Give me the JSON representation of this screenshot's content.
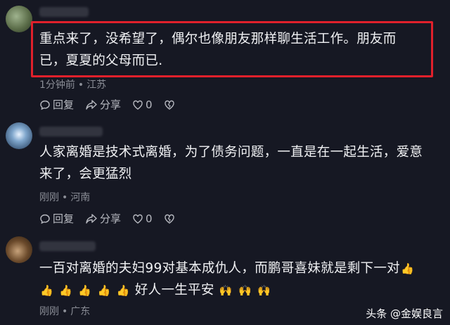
{
  "comments": [
    {
      "text": "重点来了，没希望了，偶尔也像朋友那样聊生活工作。朋友而已，夏夏的父母而已.",
      "time": "1分钟前",
      "location": "江苏",
      "reply_label": "回复",
      "share_label": "分享",
      "likes": "0"
    },
    {
      "text": "人家离婚是技术式离婚，为了债务问题，一直是在一起生活，爱意来了，会更猛烈",
      "time": "刚刚",
      "location": "河南",
      "reply_label": "回复",
      "share_label": "分享",
      "likes": "0"
    },
    {
      "text_part1": "一百对离婚的夫妇99对基本成仇人，而鹏哥喜妹就是剩下一对",
      "text_part2": "好人一生平安",
      "time": "刚刚",
      "location": "广东"
    }
  ],
  "watermark": "头条 @金娱良言",
  "colors": {
    "highlight": "#e0202b",
    "background": "#161823"
  },
  "icons": [
    "reply-icon",
    "share-icon",
    "heart-icon",
    "broken-heart-icon",
    "thumbs-up-emoji",
    "hands-up-emoji"
  ]
}
